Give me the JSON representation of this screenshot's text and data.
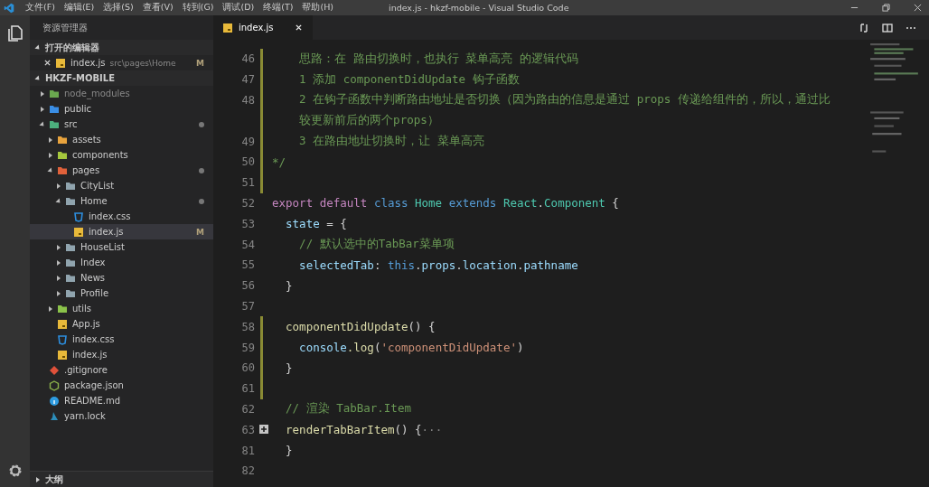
{
  "window": {
    "title": "index.js - hkzf-mobile - Visual Studio Code"
  },
  "menu": [
    "文件(F)",
    "编辑(E)",
    "选择(S)",
    "查看(V)",
    "转到(G)",
    "调试(D)",
    "终端(T)",
    "帮助(H)"
  ],
  "sidebar": {
    "title": "资源管理器",
    "open_editors": {
      "label": "打开的编辑器",
      "expanded": true,
      "items": [
        {
          "name": "index.js",
          "path": "src\\pages\\Home",
          "kind": "js",
          "badge": "M"
        }
      ]
    },
    "project": {
      "label": "HKZF-MOBILE",
      "expanded": true,
      "tree": [
        {
          "name": "node_modules",
          "kind": "folder",
          "color": "#6aa84f",
          "expanded": false,
          "dimmed": true,
          "dot": false
        },
        {
          "name": "public",
          "kind": "folder",
          "color": "#3a8ee6",
          "expanded": false,
          "dimmed": false,
          "dot": false
        },
        {
          "name": "src",
          "kind": "folder",
          "color": "#4caf7d",
          "expanded": true,
          "dimmed": false,
          "dot": true,
          "children": [
            {
              "name": "assets",
              "kind": "folder",
              "color": "#e8a33d",
              "expanded": false,
              "dimmed": false,
              "dot": false
            },
            {
              "name": "components",
              "kind": "folder",
              "color": "#a5c73d",
              "expanded": false,
              "dimmed": false,
              "dot": false
            },
            {
              "name": "pages",
              "kind": "folder",
              "color": "#e0613a",
              "expanded": true,
              "dimmed": false,
              "dot": true,
              "children": [
                {
                  "name": "CityList",
                  "kind": "folder",
                  "color": "#90a4ae",
                  "expanded": false,
                  "dimmed": false,
                  "dot": false
                },
                {
                  "name": "Home",
                  "kind": "folder",
                  "color": "#90a4ae",
                  "expanded": true,
                  "dimmed": false,
                  "dot": true,
                  "children": [
                    {
                      "name": "index.css",
                      "kind": "css",
                      "selected": false
                    },
                    {
                      "name": "index.js",
                      "kind": "js",
                      "selected": true,
                      "badge": "M"
                    }
                  ]
                },
                {
                  "name": "HouseList",
                  "kind": "folder",
                  "color": "#90a4ae",
                  "expanded": false,
                  "dimmed": false,
                  "dot": false
                },
                {
                  "name": "Index",
                  "kind": "folder",
                  "color": "#90a4ae",
                  "expanded": false,
                  "dimmed": false,
                  "dot": false
                },
                {
                  "name": "News",
                  "kind": "folder",
                  "color": "#90a4ae",
                  "expanded": false,
                  "dimmed": false,
                  "dot": false
                },
                {
                  "name": "Profile",
                  "kind": "folder",
                  "color": "#90a4ae",
                  "expanded": false,
                  "dimmed": false,
                  "dot": false
                }
              ]
            },
            {
              "name": "utils",
              "kind": "folder",
              "color": "#8bc34a",
              "expanded": false,
              "dimmed": false,
              "dot": false
            },
            {
              "name": "App.js",
              "kind": "js",
              "selected": false
            },
            {
              "name": "index.css",
              "kind": "css",
              "selected": false
            },
            {
              "name": "index.js",
              "kind": "js",
              "selected": false
            }
          ]
        },
        {
          "name": ".gitignore",
          "kind": "git",
          "selected": false
        },
        {
          "name": "package.json",
          "kind": "json",
          "selected": false
        },
        {
          "name": "README.md",
          "kind": "info",
          "selected": false
        },
        {
          "name": "yarn.lock",
          "kind": "yarn",
          "selected": false
        }
      ]
    },
    "outline": {
      "label": "大纲",
      "expanded": false
    }
  },
  "tabs": [
    {
      "label": "index.js",
      "kind": "js",
      "selected": true
    }
  ],
  "editor": {
    "lines": [
      {
        "number": "46",
        "modified": true,
        "folded": false,
        "tokens": [
          {
            "text": "    思路：在 路由切换时，也执行 菜单高亮 的逻辑代码",
            "kind": "comment"
          }
        ]
      },
      {
        "number": "47",
        "modified": true,
        "folded": false,
        "tokens": [
          {
            "text": "    1 添加 componentDidUpdate 钩子函数",
            "kind": "comment"
          }
        ]
      },
      {
        "number": "48",
        "modified": true,
        "folded": false,
        "tokens": [
          {
            "text": "    2 在钩子函数中判断路由地址是否切换（因为路由的信息是通过 props 传递给组件的，所以，通过比",
            "kind": "comment"
          }
        ]
      },
      {
        "modified": true,
        "folded": false,
        "tokens": [
          {
            "text": "    较更新前后的两个props）",
            "kind": "comment"
          }
        ]
      },
      {
        "number": "49",
        "modified": true,
        "folded": false,
        "tokens": [
          {
            "text": "    3 在路由地址切换时，让 菜单高亮",
            "kind": "comment"
          }
        ]
      },
      {
        "number": "50",
        "modified": true,
        "folded": false,
        "tokens": [
          {
            "text": "*/",
            "kind": "comment"
          }
        ]
      },
      {
        "number": "51",
        "modified": true,
        "folded": false
      },
      {
        "number": "52",
        "modified": false,
        "folded": false,
        "tokens": [
          {
            "text": "export default ",
            "kind": "keyword"
          },
          {
            "text": "class ",
            "kind": "storage"
          },
          {
            "text": "Home ",
            "kind": "type"
          },
          {
            "text": "extends ",
            "kind": "storage"
          },
          {
            "text": "React",
            "kind": "type"
          },
          {
            "text": ".",
            "kind": "plain"
          },
          {
            "text": "Component",
            "kind": "type"
          },
          {
            "text": " {",
            "kind": "plain"
          }
        ]
      },
      {
        "number": "53",
        "modified": false,
        "folded": false,
        "tokens": [
          {
            "text": "  state",
            "kind": "variable"
          },
          {
            "text": " = {",
            "kind": "plain"
          }
        ]
      },
      {
        "number": "54",
        "modified": false,
        "folded": false,
        "tokens": [
          {
            "text": "    // 默认选中的TabBar菜单项",
            "kind": "comment"
          }
        ]
      },
      {
        "number": "55",
        "modified": false,
        "folded": false,
        "tokens": [
          {
            "text": "    selectedTab",
            "kind": "variable"
          },
          {
            "text": ": ",
            "kind": "plain"
          },
          {
            "text": "this",
            "kind": "storage"
          },
          {
            "text": ".",
            "kind": "plain"
          },
          {
            "text": "props",
            "kind": "variable"
          },
          {
            "text": ".",
            "kind": "plain"
          },
          {
            "text": "location",
            "kind": "variable"
          },
          {
            "text": ".",
            "kind": "plain"
          },
          {
            "text": "pathname",
            "kind": "variable"
          }
        ]
      },
      {
        "number": "56",
        "modified": false,
        "folded": false,
        "tokens": [
          {
            "text": "  }",
            "kind": "plain"
          }
        ]
      },
      {
        "number": "57",
        "modified": false,
        "folded": false
      },
      {
        "number": "58",
        "modified": true,
        "folded": false,
        "tokens": [
          {
            "text": "  componentDidUpdate",
            "kind": "function"
          },
          {
            "text": "() {",
            "kind": "plain"
          }
        ]
      },
      {
        "number": "59",
        "modified": true,
        "folded": false,
        "tokens": [
          {
            "text": "    console",
            "kind": "variable"
          },
          {
            "text": ".log",
            "kind": "function"
          },
          {
            "text": "(",
            "kind": "plain"
          },
          {
            "text": "'componentDidUpdate'",
            "kind": "string"
          },
          {
            "text": ")",
            "kind": "plain"
          }
        ]
      },
      {
        "number": "60",
        "modified": true,
        "folded": false,
        "tokens": [
          {
            "text": "  }",
            "kind": "plain"
          }
        ]
      },
      {
        "number": "61",
        "modified": true,
        "folded": false
      },
      {
        "number": "62",
        "modified": false,
        "folded": false,
        "tokens": [
          {
            "text": "  // 渲染 TabBar.Item",
            "kind": "comment"
          }
        ]
      },
      {
        "number": "63",
        "modified": false,
        "folded": true,
        "tokens": [
          {
            "text": "  renderTabBarItem",
            "kind": "function"
          },
          {
            "text": "() {",
            "kind": "plain"
          },
          {
            "text": "···",
            "kind": "fold"
          }
        ]
      },
      {
        "number": "81",
        "modified": false,
        "folded": false,
        "tokens": [
          {
            "text": "  }",
            "kind": "plain"
          }
        ]
      },
      {
        "number": "82",
        "modified": false,
        "folded": false
      }
    ]
  }
}
